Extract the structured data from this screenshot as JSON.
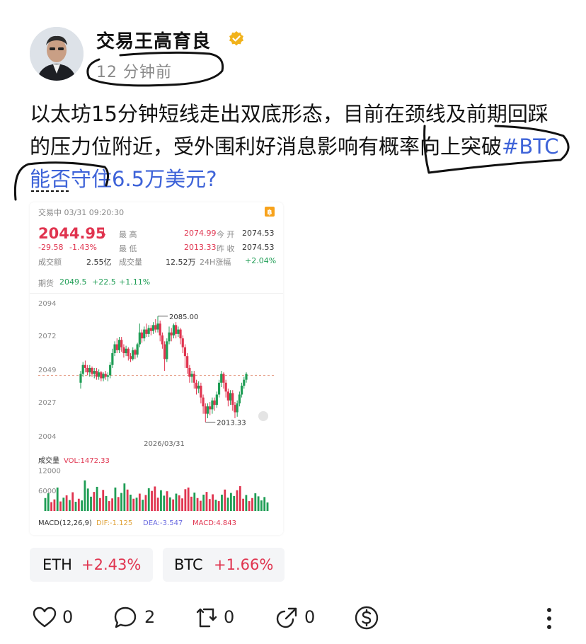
{
  "post": {
    "author": "交易王高育良",
    "time": "12 分钟前",
    "text_main": "以太坊15分钟短线走出双底形态，目前在颈线及前期回踩的压力位附近，受外围利好消息影响有概率向上突破",
    "hashtag": "#BTC能否守住6.5万美元?"
  },
  "chart_card": {
    "status_time": "交易中 03/31 09:20:30",
    "price": "2044.95",
    "change": "-29.58",
    "change_pct": "-1.43%",
    "high_label": "最 高",
    "high": "2074.99",
    "open_label": "今 开",
    "open": "2074.53",
    "low_label": "最 低",
    "low": "2013.33",
    "prev_label": "昨 收",
    "prev": "2074.53",
    "amount_label": "成交额",
    "amount": "2.55亿",
    "volume_label": "成交量",
    "volume": "12.52万",
    "change24_label": "24H涨幅",
    "change24": "+2.04%",
    "futures_label": "期货",
    "futures_price": "2049.5",
    "futures_change": "+22.5",
    "futures_pct": "+1.11%",
    "date_label": "2026/03/31",
    "max_label": "2085.00",
    "min_label": "2013.33",
    "vol_title": "成交量",
    "vol_value": "VOL:1472.33",
    "macd_title": "MACD(12,26,9)",
    "dif": "DIF:-1.125",
    "dea": "DEA:-3.547",
    "macd": "MACD:4.843"
  },
  "chart_data": {
    "type": "candlestick",
    "y_ticks": [
      "2094",
      "2072",
      "2049",
      "2027",
      "2004"
    ],
    "ylim": [
      2004,
      2094
    ],
    "reference_price": 2044.95,
    "high_marker": 2085.0,
    "low_marker": 2013.33,
    "candles": [
      [
        2040,
        2046,
        2036,
        2048
      ],
      [
        2046,
        2052,
        2044,
        2054
      ],
      [
        2052,
        2050,
        2047,
        2055
      ],
      [
        2050,
        2047,
        2045,
        2052
      ],
      [
        2047,
        2050,
        2044,
        2052
      ],
      [
        2050,
        2046,
        2044,
        2051
      ],
      [
        2046,
        2048,
        2043,
        2050
      ],
      [
        2048,
        2044,
        2042,
        2050
      ],
      [
        2044,
        2047,
        2042,
        2049
      ],
      [
        2047,
        2043,
        2041,
        2048
      ],
      [
        2043,
        2046,
        2041,
        2047
      ],
      [
        2046,
        2044,
        2042,
        2048
      ],
      [
        2044,
        2045,
        2041,
        2047
      ],
      [
        2045,
        2052,
        2043,
        2054
      ],
      [
        2052,
        2060,
        2050,
        2063
      ],
      [
        2060,
        2066,
        2058,
        2068
      ],
      [
        2066,
        2062,
        2060,
        2070
      ],
      [
        2062,
        2069,
        2060,
        2071
      ],
      [
        2069,
        2064,
        2061,
        2071
      ],
      [
        2064,
        2060,
        2057,
        2066
      ],
      [
        2060,
        2063,
        2058,
        2065
      ],
      [
        2063,
        2058,
        2055,
        2064
      ],
      [
        2058,
        2056,
        2054,
        2060
      ],
      [
        2056,
        2062,
        2055,
        2064
      ],
      [
        2062,
        2059,
        2056,
        2063
      ],
      [
        2059,
        2066,
        2057,
        2067
      ],
      [
        2066,
        2074,
        2064,
        2080
      ],
      [
        2074,
        2070,
        2067,
        2076
      ],
      [
        2070,
        2076,
        2068,
        2078
      ],
      [
        2076,
        2073,
        2071,
        2080
      ],
      [
        2073,
        2077,
        2071,
        2079
      ],
      [
        2077,
        2075,
        2072,
        2079
      ],
      [
        2075,
        2079,
        2073,
        2081
      ],
      [
        2079,
        2076,
        2074,
        2083
      ],
      [
        2076,
        2080,
        2074,
        2085
      ],
      [
        2080,
        2072,
        2068,
        2082
      ],
      [
        2072,
        2066,
        2063,
        2074
      ],
      [
        2066,
        2056,
        2048,
        2068
      ],
      [
        2056,
        2068,
        2054,
        2070
      ],
      [
        2068,
        2074,
        2066,
        2078
      ],
      [
        2074,
        2072,
        2068,
        2077
      ],
      [
        2072,
        2079,
        2070,
        2080
      ],
      [
        2079,
        2073,
        2070,
        2081
      ],
      [
        2073,
        2076,
        2071,
        2078
      ],
      [
        2076,
        2070,
        2066,
        2077
      ],
      [
        2070,
        2064,
        2060,
        2072
      ],
      [
        2064,
        2058,
        2050,
        2066
      ],
      [
        2058,
        2050,
        2046,
        2060
      ],
      [
        2050,
        2044,
        2040,
        2052
      ],
      [
        2044,
        2046,
        2040,
        2048
      ],
      [
        2046,
        2040,
        2036,
        2048
      ],
      [
        2040,
        2036,
        2032,
        2042
      ],
      [
        2036,
        2038,
        2033,
        2041
      ],
      [
        2038,
        2030,
        2026,
        2040
      ],
      [
        2030,
        2024,
        2019,
        2032
      ],
      [
        2024,
        2019,
        2013.33,
        2026
      ],
      [
        2019,
        2024,
        2016,
        2026
      ],
      [
        2024,
        2022,
        2018,
        2027
      ],
      [
        2022,
        2028,
        2019,
        2030
      ],
      [
        2028,
        2025,
        2021,
        2030
      ],
      [
        2025,
        2032,
        2023,
        2034
      ],
      [
        2032,
        2040,
        2030,
        2042
      ],
      [
        2040,
        2046,
        2037,
        2048
      ],
      [
        2046,
        2040,
        2036,
        2047
      ],
      [
        2040,
        2034,
        2030,
        2042
      ],
      [
        2034,
        2028,
        2024,
        2036
      ],
      [
        2028,
        2033,
        2025,
        2035
      ],
      [
        2033,
        2025,
        2021,
        2035
      ],
      [
        2025,
        2020,
        2016,
        2027
      ],
      [
        2020,
        2026,
        2017,
        2028
      ],
      [
        2026,
        2032,
        2024,
        2034
      ],
      [
        2032,
        2038,
        2030,
        2040
      ],
      [
        2038,
        2042,
        2036,
        2044
      ],
      [
        2042,
        2046,
        2040,
        2047
      ]
    ],
    "volume_ticks": [
      "12000",
      "6000"
    ],
    "volumes": [
      3800,
      5200,
      2600,
      3400,
      6900,
      2800,
      3900,
      4600,
      3200,
      5500,
      2700,
      3600,
      3100,
      9000,
      6600,
      4200,
      5600,
      7100,
      3800,
      6200,
      4400,
      2900,
      3700,
      6900,
      4100,
      5300,
      8100,
      6300,
      4800,
      3600,
      3900,
      5100,
      3300,
      4700,
      6700,
      5900,
      7200,
      3900,
      6100,
      4500,
      5800,
      4000,
      3400,
      5100,
      4600,
      3700,
      6400,
      6900,
      4200,
      5400,
      3800,
      3000,
      4800,
      5600,
      3500,
      4900,
      3300,
      2900,
      4800,
      6300,
      3900,
      5300,
      4400,
      6100,
      7300,
      3600,
      4700,
      2900,
      3800,
      5200,
      4300,
      3100,
      4100,
      2500
    ],
    "volume_max": 12500
  },
  "tickers": [
    {
      "symbol": "ETH",
      "change": "+2.43%"
    },
    {
      "symbol": "BTC",
      "change": "+1.66%"
    }
  ],
  "actions": {
    "like": "0",
    "comment": "2",
    "repost": "0",
    "share": "0"
  },
  "colors": {
    "up": "#1f9d55",
    "down": "#e0344f",
    "hashtag": "#3e63d8",
    "verified": "#f1b21a"
  }
}
